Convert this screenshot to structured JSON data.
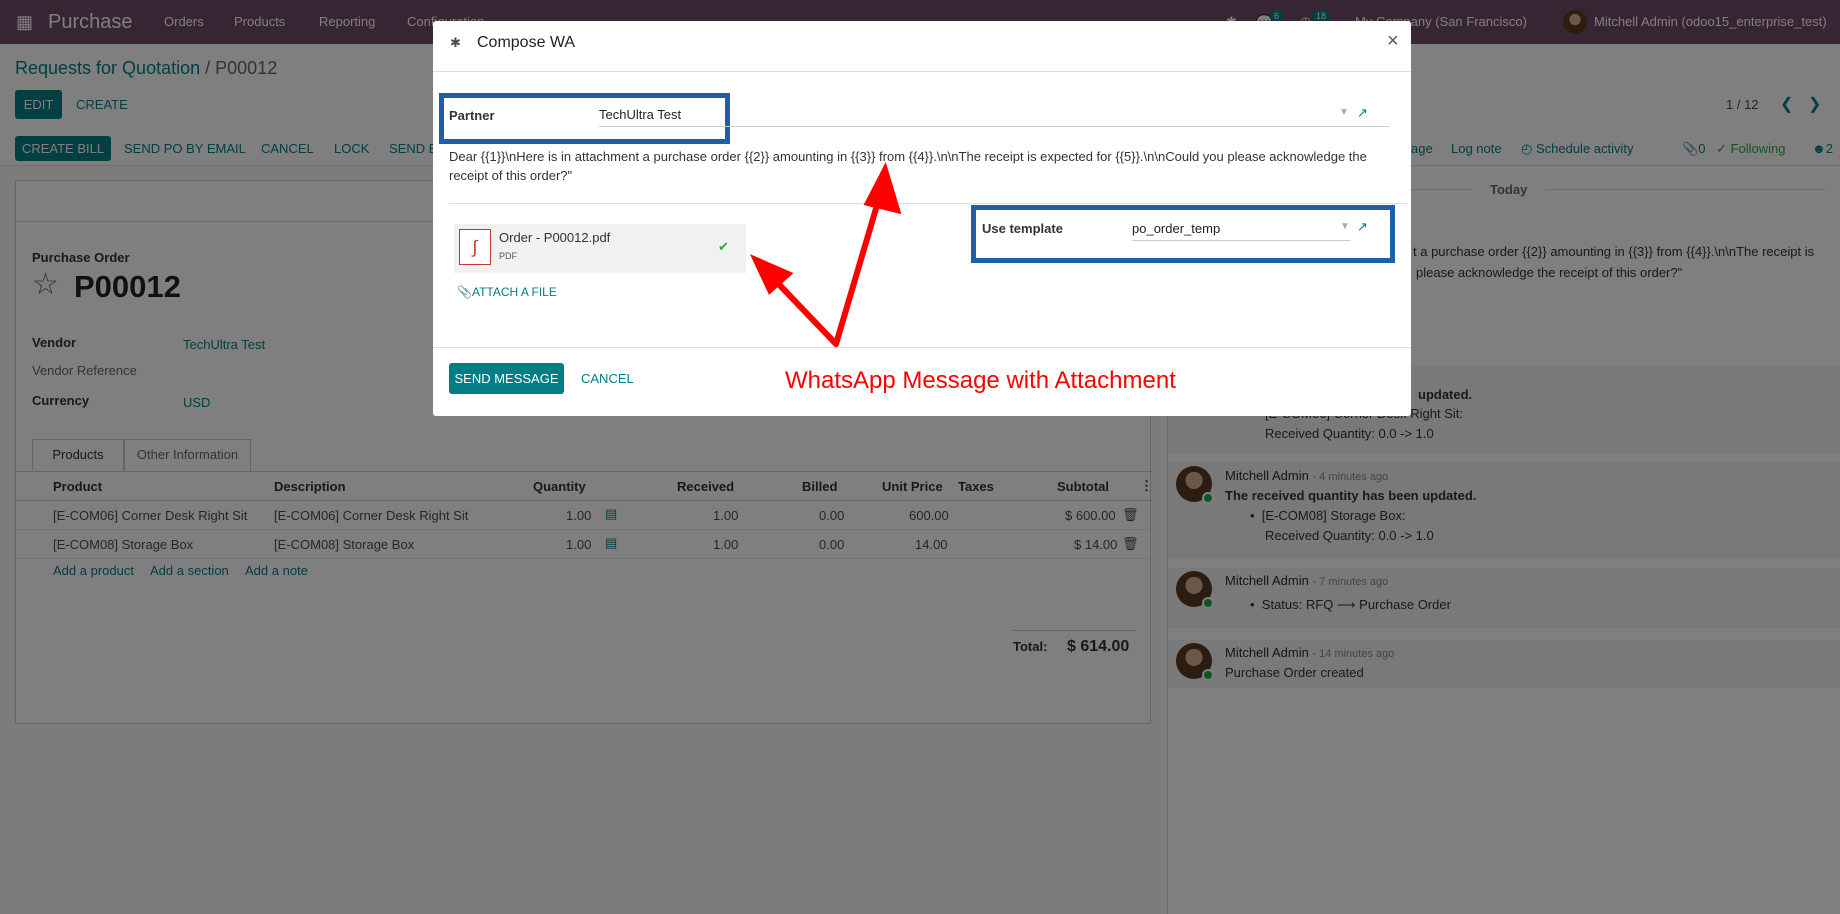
{
  "navbar": {
    "app_title": "Purchase",
    "menu": [
      "Orders",
      "Products",
      "Reporting",
      "Configuration"
    ],
    "messages_count": "6",
    "activities_count": "18",
    "company": "My Company (San Francisco)",
    "user": "Mitchell Admin (odoo15_enterprise_test)"
  },
  "breadcrumb": {
    "parent": "Requests for Quotation",
    "separator": "/",
    "current": "P00012"
  },
  "control": {
    "edit": "EDIT",
    "create": "CREATE",
    "pager": "1 / 12"
  },
  "statusbar": {
    "buttons": [
      "CREATE BILL",
      "SEND PO BY EMAIL",
      "CANCEL",
      "LOCK",
      "SEND B"
    ]
  },
  "chatter_topbar": {
    "send_message_tail": "age",
    "log_note": "Log note",
    "schedule_activity": "Schedule activity",
    "attachments_count": "0",
    "following": "Following",
    "followers_count": "2"
  },
  "form": {
    "title_label": "Purchase Order",
    "name": "P00012",
    "vendor_label": "Vendor",
    "vendor": "TechUltra Test",
    "vendor_ref_label": "Vendor Reference",
    "currency_label": "Currency",
    "currency": "USD",
    "tabs": [
      "Products",
      "Other Information"
    ],
    "columns": [
      "Product",
      "Description",
      "Quantity",
      "Received",
      "Billed",
      "Unit Price",
      "Taxes",
      "Subtotal"
    ],
    "lines": [
      {
        "product": "[E-COM06] Corner Desk Right Sit",
        "description": "[E-COM06] Corner Desk Right Sit",
        "quantity": "1.00",
        "received": "1.00",
        "billed": "0.00",
        "unit_price": "600.00",
        "taxes": "",
        "subtotal": "$ 600.00"
      },
      {
        "product": "[E-COM08] Storage Box",
        "description": "[E-COM08] Storage Box",
        "quantity": "1.00",
        "received": "1.00",
        "billed": "0.00",
        "unit_price": "14.00",
        "taxes": "",
        "subtotal": "$ 14.00"
      }
    ],
    "add_product": "Add a product",
    "add_section": "Add a section",
    "add_note": "Add a note",
    "total_label": "Total:",
    "total": "$ 614.00"
  },
  "chatter": {
    "today": "Today",
    "partial_line1": "t a purchase order {{2}} amounting in {{3}} from {{4}}.\\n\\nThe receipt is",
    "partial_line2": "please acknowledge the receipt of this order?\"",
    "partial_updated": "updated.",
    "partial_item": "[E-COM06] Corner Desk Right Sit:",
    "partial_qty": "Received Quantity: 0.0 -> 1.0",
    "messages": [
      {
        "author": "Mitchell Admin",
        "when": "- 4 minutes ago",
        "title": "The received quantity has been updated.",
        "item": "[E-COM08] Storage Box:",
        "detail": "Received Quantity: 0.0 -> 1.0"
      },
      {
        "author": "Mitchell Admin",
        "when": "- 7 minutes ago",
        "item": "Status: RFQ ⟶ Purchase Order"
      },
      {
        "author": "Mitchell Admin",
        "when": "- 14 minutes ago",
        "body": "Purchase Order created"
      }
    ]
  },
  "modal": {
    "title": "Compose WA",
    "close": "×",
    "partner_label": "Partner",
    "partner_value": "TechUltra Test",
    "body_text": "Dear {{1}}\\nHere is in attachment a purchase order {{2}} amounting in {{3}} from {{4}}.\\n\\nThe receipt is expected for {{5}}.\\n\\nCould you please acknowledge the receipt of this order?\"",
    "attachment_name": "Order - P00012.pdf",
    "attachment_type": "PDF",
    "attach_file": "ATTACH A FILE",
    "template_label": "Use template",
    "template_value": "po_order_temp",
    "send": "SEND MESSAGE",
    "cancel": "CANCEL",
    "annotation": "WhatsApp Message with Attachment"
  },
  "colors": {
    "brand": "#714B67",
    "primary": "#017e84",
    "highlight_box": "#1f5fa8",
    "annotation": "#ff0000"
  }
}
